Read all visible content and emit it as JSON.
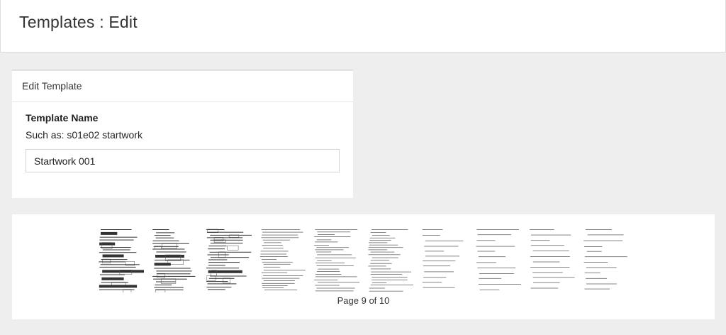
{
  "header": {
    "title": "Templates : Edit"
  },
  "panel": {
    "title": "Edit Template",
    "field_label": "Template Name",
    "field_help": "Such as: s01e02 startwork",
    "field_value": "Startwork 001"
  },
  "gallery": {
    "pages": [
      {
        "name": "page-thumbnail-1",
        "style": "dense"
      },
      {
        "name": "page-thumbnail-2",
        "style": "dense"
      },
      {
        "name": "page-thumbnail-3",
        "style": "dense"
      },
      {
        "name": "page-thumbnail-4",
        "style": "medium"
      },
      {
        "name": "page-thumbnail-5",
        "style": "medium"
      },
      {
        "name": "page-thumbnail-6",
        "style": "medium"
      },
      {
        "name": "page-thumbnail-7",
        "style": "light"
      },
      {
        "name": "page-thumbnail-8",
        "style": "light"
      },
      {
        "name": "page-thumbnail-9",
        "style": "light"
      },
      {
        "name": "page-thumbnail-10",
        "style": "light"
      }
    ],
    "pager_text": "Page 9 of 10"
  }
}
